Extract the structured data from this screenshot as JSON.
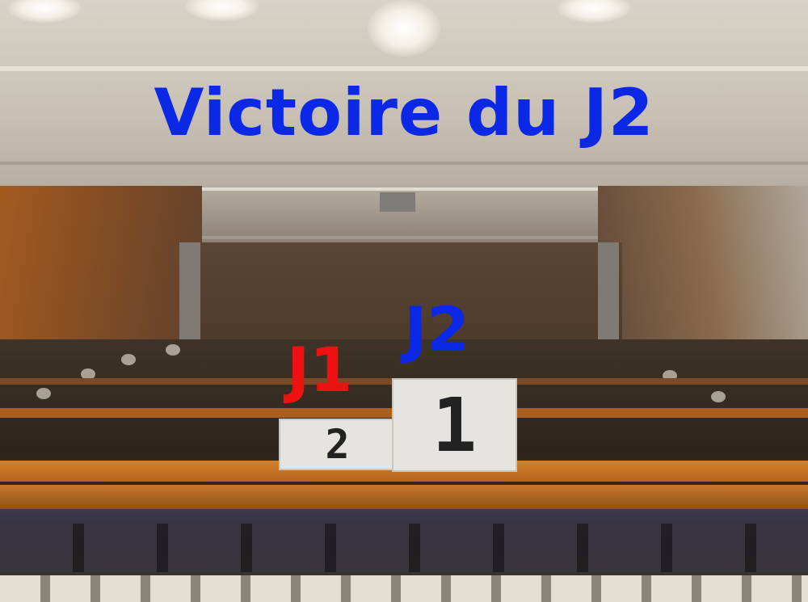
{
  "title": "Victoire du J2",
  "colors": {
    "title": "#0a28e6",
    "player_1": "#ee1111",
    "player_2": "#0a28e6",
    "podium": "#e6e4e0"
  },
  "podium": {
    "first": {
      "player": "J2",
      "rank": "1"
    },
    "second": {
      "player": "J1",
      "rank": "2"
    }
  }
}
